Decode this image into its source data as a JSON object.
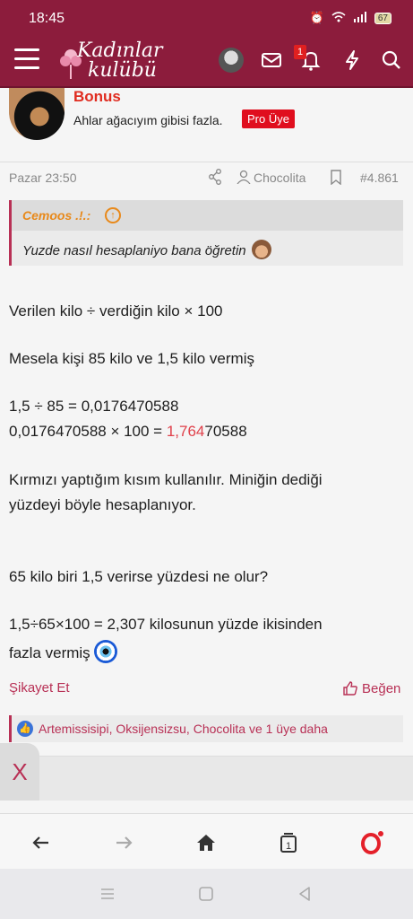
{
  "status_bar": {
    "time": "18:45",
    "battery": "67"
  },
  "app_bar": {
    "logo_line1": "Kadınlar",
    "logo_line2": "kulübü",
    "notification_count": "1"
  },
  "post": {
    "username": "Bonus",
    "user_title": "Ahlar ağacıyım gibisi fazla.",
    "badge": "Pro Üye",
    "date": "Pazar 23:50",
    "author": "Chocolita",
    "post_number": "#4.861",
    "quote": {
      "name": "Cemoos .!.:",
      "text": "Yuzde nasıl hesaplaniyo bana öğretin"
    },
    "body": {
      "line1": "Verilen kilo ÷ verdiğin kilo × 100",
      "line2": "Mesela kişi 85 kilo ve 1,5 kilo vermiş",
      "line3": "1,5 ÷ 85 = 0,0176470588",
      "line4_pre": "0,0176470588 × 100 = ",
      "line4_red": "1,764",
      "line4_post": "70588",
      "line5": "Kırmızı yaptığım kısım kullanılır. Miniğin dediği",
      "line6": "yüzdeyi böyle hesaplanıyor.",
      "line7": "65 kilo biri 1,5 verirse yüzdesi ne olur?",
      "line8": "1,5÷65×100 = 2,307 kilosunun yüzde ikisinden",
      "line9": "fazla vermiş"
    },
    "report_label": "Şikayet Et",
    "like_label": "Beğen",
    "reactions_text": "Artemissisipi, Oksijensizsu, Chocolita ve 1 üye daha"
  },
  "dismiss_label": "X"
}
